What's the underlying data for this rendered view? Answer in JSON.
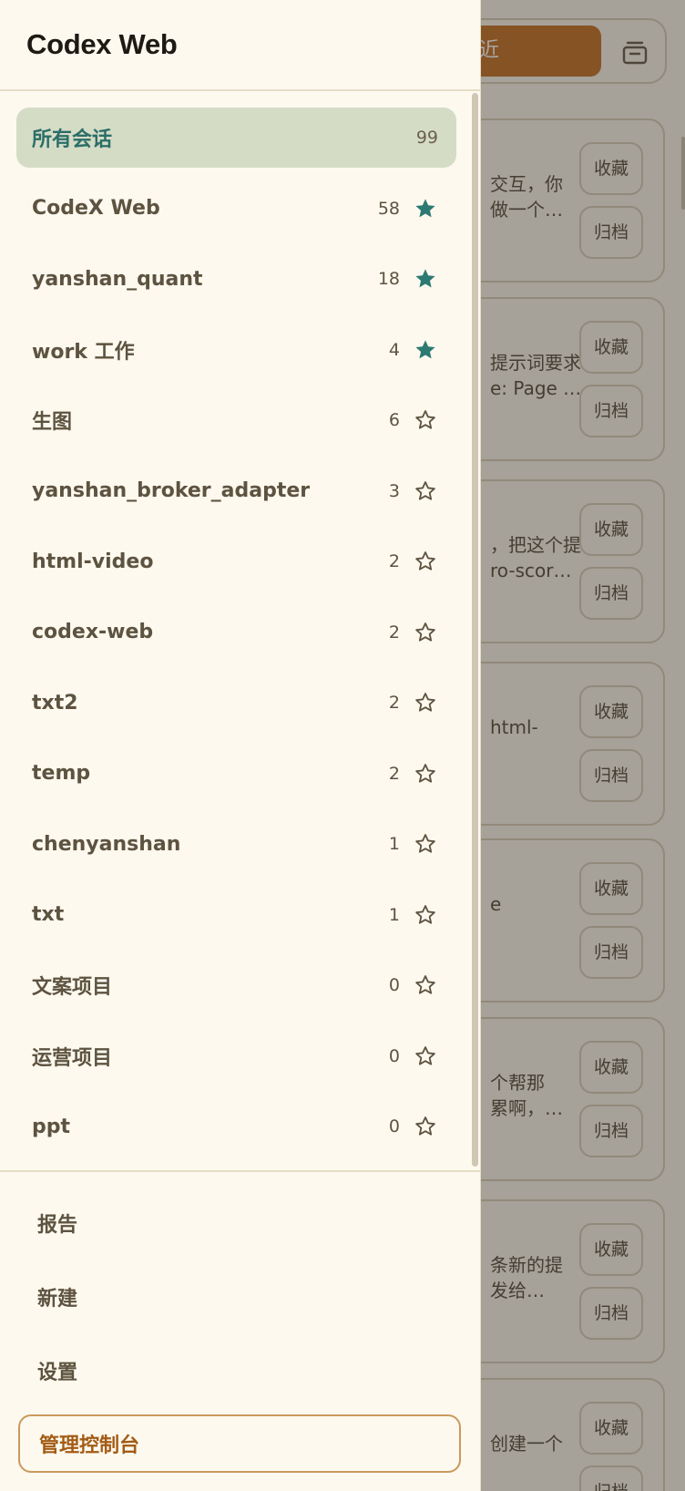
{
  "drawer": {
    "title": "Codex Web",
    "items": [
      {
        "label": "所有会话",
        "count": "99",
        "active": true,
        "starred": null
      },
      {
        "label": "CodeX Web",
        "count": "58",
        "active": false,
        "starred": true
      },
      {
        "label": "yanshan_quant",
        "count": "18",
        "active": false,
        "starred": true
      },
      {
        "label": "work  工作",
        "count": "4",
        "active": false,
        "starred": true
      },
      {
        "label": "生图",
        "count": "6",
        "active": false,
        "starred": false
      },
      {
        "label": "yanshan_broker_adapter",
        "count": "3",
        "active": false,
        "starred": false
      },
      {
        "label": "html-video",
        "count": "2",
        "active": false,
        "starred": false
      },
      {
        "label": "codex-web",
        "count": "2",
        "active": false,
        "starred": false
      },
      {
        "label": "txt2",
        "count": "2",
        "active": false,
        "starred": false
      },
      {
        "label": "temp",
        "count": "2",
        "active": false,
        "starred": false
      },
      {
        "label": "chenyanshan",
        "count": "1",
        "active": false,
        "starred": false
      },
      {
        "label": "txt",
        "count": "1",
        "active": false,
        "starred": false
      },
      {
        "label": "文案项目",
        "count": "0",
        "active": false,
        "starred": false
      },
      {
        "label": "运营项目",
        "count": "0",
        "active": false,
        "starred": false
      },
      {
        "label": "ppt",
        "count": "0",
        "active": false,
        "starred": false
      }
    ],
    "footer": {
      "report": "报告",
      "new": "新建",
      "settings": "设置",
      "admin": "管理控制台"
    }
  },
  "background": {
    "recent_button": "近",
    "cards": [
      {
        "line1": "交互，你",
        "line2": "做一个…",
        "favorite": "收藏",
        "archive": "归档"
      },
      {
        "line1": "提示词要求",
        "line2": "e: Page …",
        "favorite": "收藏",
        "archive": "归档"
      },
      {
        "line1": "，把这个提",
        "line2": "ro-scor…",
        "favorite": "收藏",
        "archive": "归档"
      },
      {
        "line1": "html-",
        "line2": "",
        "favorite": "收藏",
        "archive": "归档"
      },
      {
        "line1": "e",
        "line2": "",
        "favorite": "收藏",
        "archive": "归档"
      },
      {
        "line1": "个帮那",
        "line2": "累啊，…",
        "favorite": "收藏",
        "archive": "归档"
      },
      {
        "line1": "条新的提",
        "line2": "发给…",
        "favorite": "收藏",
        "archive": "归档"
      },
      {
        "line1": "创建一个",
        "line2": "",
        "favorite": "收藏",
        "archive": "归档"
      }
    ]
  },
  "colors": {
    "accent": "#c46b1c",
    "active_bg": "#d5dcc6",
    "active_text": "#2c6e68",
    "star_filled": "#2c7a72",
    "admin_text": "#a35c15"
  }
}
